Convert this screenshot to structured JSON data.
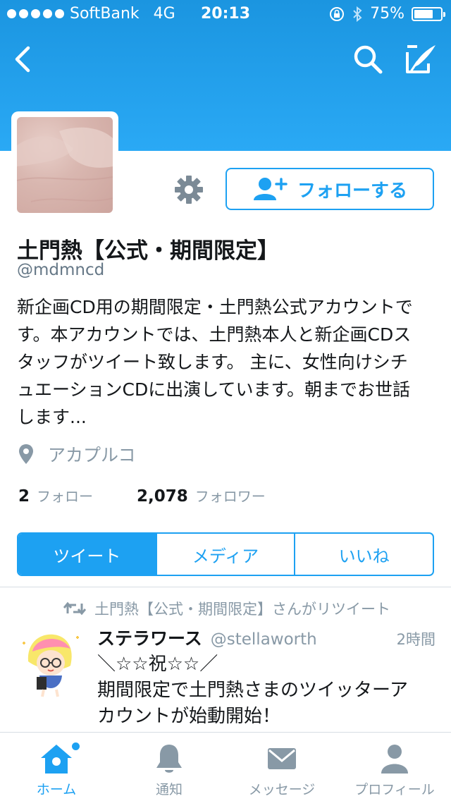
{
  "status_bar": {
    "carrier": "SoftBank",
    "network": "4G",
    "time": "20:13",
    "battery_percent": "75%",
    "battery_level": 0.75
  },
  "nav": {
    "back_icon": "chevron-left-icon",
    "search_icon": "search-icon",
    "compose_icon": "compose-tweet-icon"
  },
  "profile": {
    "name": "土門熱【公式・期間限定】",
    "handle": "@mdmncd",
    "bio_lines": [
      "新企画CD用の期間限定・土門熱公式アカウントで",
      "す。本アカウントでは、土門熱本人と新企画CDス",
      "タッフがツイート致します。 主に、女性向けシチ",
      "ュエーションCDに出演しています。朝までお世話",
      "します..."
    ],
    "location": "アカプルコ",
    "following_count": "2",
    "following_label": "フォロー",
    "followers_count": "2,078",
    "followers_label": "フォロワー",
    "follow_button": "フォローする"
  },
  "tabs": [
    {
      "label": "ツイート",
      "active": true
    },
    {
      "label": "メディア",
      "active": false
    },
    {
      "label": "いいね",
      "active": false
    }
  ],
  "tweet": {
    "retweet_line": "土門熱【公式・期間限定】さんがリツイート",
    "author_name": "ステラワース",
    "author_handle": "@stellaworth",
    "time": "2時間",
    "text_lines": [
      "＼☆☆祝☆☆／",
      "期間限定で土門熱さまのツイッターア",
      "カウントが始動開始！"
    ]
  },
  "bottom_nav": [
    {
      "label": "ホーム",
      "icon": "home-icon",
      "active": true
    },
    {
      "label": "通知",
      "icon": "bell-icon",
      "active": false
    },
    {
      "label": "メッセージ",
      "icon": "envelope-icon",
      "active": false
    },
    {
      "label": "プロフィール",
      "icon": "person-icon",
      "active": false
    }
  ],
  "colors": {
    "brand_blue": "#1da1f2",
    "header_blue": "#1b95e0",
    "muted_text": "#8899a6"
  }
}
